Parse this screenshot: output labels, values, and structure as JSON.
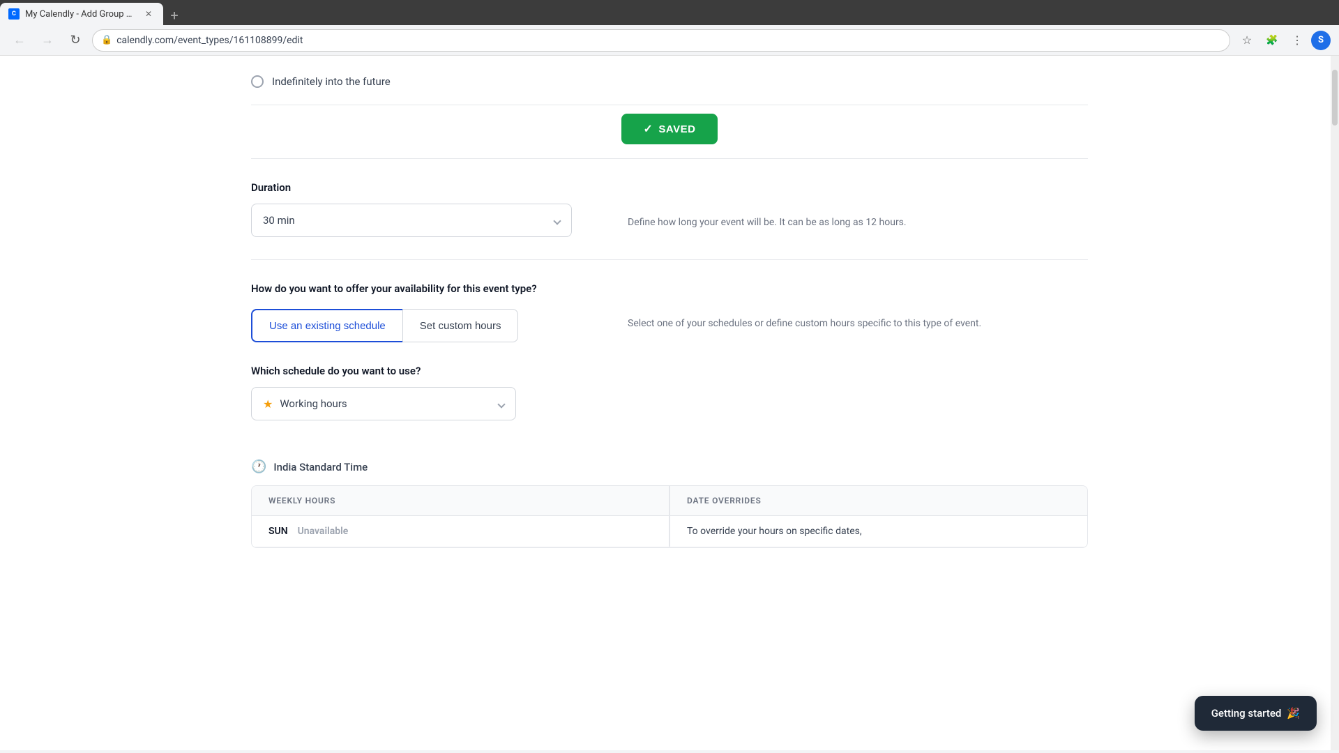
{
  "browser": {
    "tab_title": "My Calendly - Add Group Event",
    "tab_favicon": "C",
    "url": "calendly.com/event_types/161108899/edit",
    "new_tab_label": "+",
    "profile_letter": "S"
  },
  "top_section": {
    "indefinitely_label": "Indefinitely into the future"
  },
  "saved_button": {
    "label": "SAVED",
    "check_icon": "✓"
  },
  "duration_section": {
    "label": "Duration",
    "selected_value": "30 min",
    "help_text": "Define how long your event will be. It can be as long as 12 hours."
  },
  "availability_section": {
    "question": "How do you want to offer your availability for this event type?",
    "btn_existing": "Use an existing schedule",
    "btn_custom": "Set custom hours",
    "which_schedule_label": "Which schedule do you want to use?",
    "schedule_value": "Working hours",
    "help_text": "Select one of your schedules or define custom hours specific to this type of event."
  },
  "timezone": {
    "label": "India Standard Time",
    "icon": "🕐"
  },
  "hours_table": {
    "weekly_hours_col": "WEEKLY HOURS",
    "date_overrides_col": "DATE OVERRIDES",
    "day_col": "SUN",
    "day_value": "Unavailable",
    "override_text": "To override your hours on specific dates,"
  },
  "getting_started": {
    "label": "Getting started",
    "emoji": "🎉"
  }
}
